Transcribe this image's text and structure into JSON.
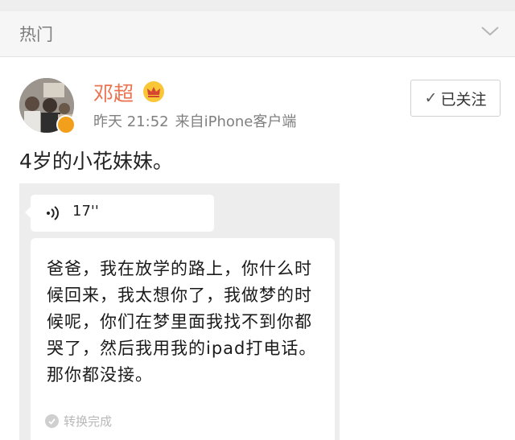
{
  "header": {
    "title": "热门",
    "expand_icon": "chevron-down-icon"
  },
  "post": {
    "author": "邓超",
    "author_badge_icon": "crown-icon",
    "verified_icon": "verified-badge-icon",
    "time": "昨天 21:52",
    "source": "来自iPhone客户端",
    "follow_label": "已关注",
    "follow_icon": "check-icon",
    "text": "4岁的小花妹妹。",
    "colors": {
      "author": "#eb7350",
      "meta": "#808080",
      "verified": "#f29f1c"
    }
  },
  "embedded_screenshot": {
    "voice_icon": "voice-wave-icon",
    "voice_duration": "17''",
    "transcript": "爸爸，我在放学的路上，你什么时候回来，我太想你了，我做梦的时候呢，你们在梦里面我找不到你都哭了，然后我用我的ipad打电话。那你都没接。",
    "status_label": "转换完成",
    "status_icon": "check-circle-icon"
  }
}
